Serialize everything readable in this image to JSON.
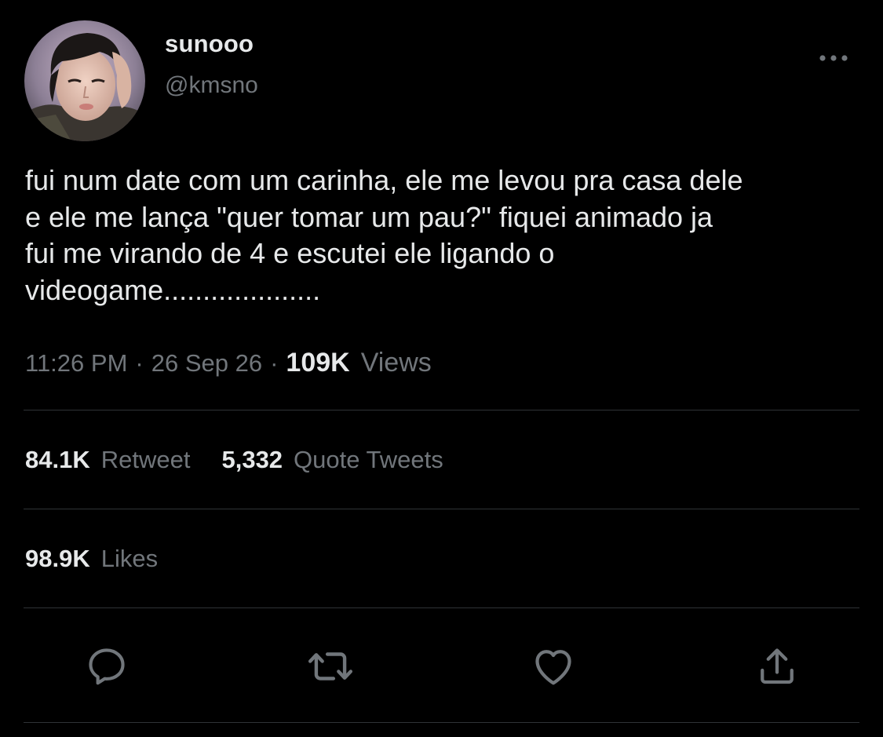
{
  "author": {
    "display_name": "sunooo",
    "handle": "@kmsno",
    "avatar_icon": "user-avatar-photo"
  },
  "tweet": {
    "text": "fui num date com um carinha, ele me levou pra casa dele\ne ele me lança \"quer tomar um pau?\" fiquei animado ja\nfui me virando de 4 e escutei ele ligando o\nvideogame...................."
  },
  "meta": {
    "time": "11:26 PM",
    "separator": "·",
    "date": "26 Sep 26",
    "views_count": "109K",
    "views_label": "Views"
  },
  "stats": {
    "retweets_count": "84.1K",
    "retweets_label": "Retweet",
    "quotes_count": "5,332",
    "quotes_label": "Quote Tweets",
    "likes_count": "98.9K",
    "likes_label": "Likes"
  },
  "actions": {
    "reply_icon": "reply-icon",
    "retweet_icon": "retweet-icon",
    "like_icon": "heart-icon",
    "share_icon": "share-icon",
    "more_icon": "more-options-icon"
  },
  "colors": {
    "background": "#000000",
    "primary_text": "#e7e9ea",
    "secondary_text": "#71767b",
    "divider": "#2f3336"
  }
}
